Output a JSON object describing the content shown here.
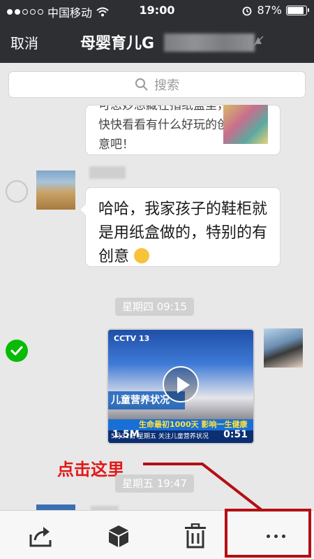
{
  "status_bar": {
    "carrier": "中国移动",
    "time": "19:00",
    "battery_text": "87%",
    "battery_level": 0.87,
    "signal_dots_filled": 2,
    "signal_dots_total": 5
  },
  "navbar": {
    "cancel_label": "取消",
    "title": "母婴育儿G"
  },
  "search": {
    "placeholder": "搜索"
  },
  "messages": {
    "partial_text": "可怎妙想藏在指纸盒里，快快看看有什么好玩的创意吧！",
    "text_message": "哈哈，我家孩子的鞋柜就是用纸盒做的，特别的有创意"
  },
  "time_dividers": [
    "星期四 09:15",
    "星期五 19:47"
  ],
  "video": {
    "channel": "CCTV 13",
    "caption": "儿童营养状况",
    "ticker": "生命最初1000天 影响一生健康",
    "ticker2": "5月31日 星期五 关注儿童营养状况",
    "size": "1.5M",
    "duration": "0:51"
  },
  "annotation": {
    "text": "点击这里",
    "color": "#e01818"
  },
  "toolbar": {
    "share_icon": "share-icon",
    "favorite_icon": "box-icon",
    "delete_icon": "trash-icon",
    "more_icon": "more-dots-icon"
  },
  "colors": {
    "nav_bg": "#2d2f33",
    "check_green": "#09bb07",
    "highlight_red": "#b40f14"
  }
}
